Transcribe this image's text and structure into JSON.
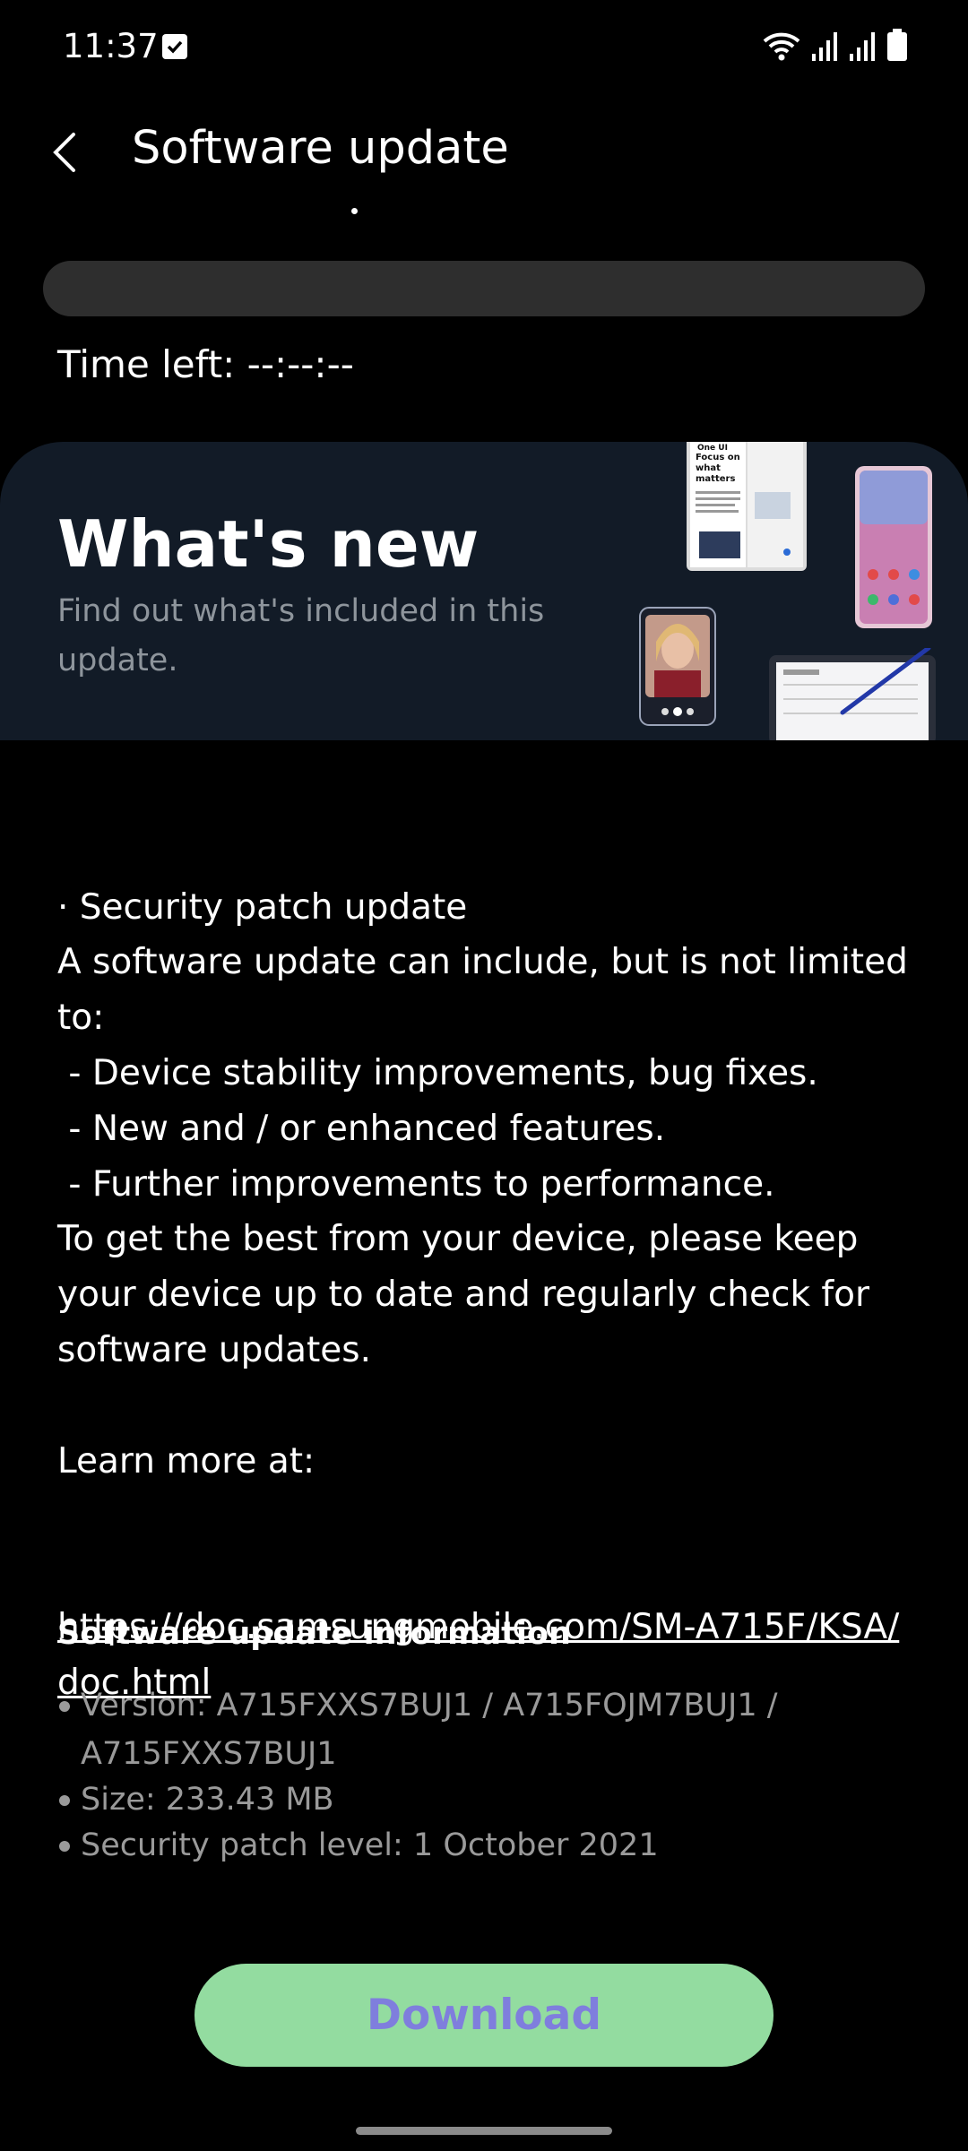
{
  "status_bar": {
    "time": "11:37",
    "icons": [
      "check-notification-icon",
      "wifi-icon",
      "signal-icon",
      "signal-icon",
      "battery-icon"
    ]
  },
  "app_bar": {
    "title": "Software update",
    "back_icon": "chevron-left-icon"
  },
  "download": {
    "progress_fraction": 0,
    "time_left": "Time left: --:--:--"
  },
  "banner": {
    "title": "What's new",
    "subtitle": "Find out what's included in this update.",
    "phone_text": {
      "brand": "One UI",
      "headline": "Focus on what matters"
    }
  },
  "release_notes": {
    "lines": [
      "· Security patch update",
      "A software update can include, but is not limited to:",
      " - Device stability improvements, bug fixes.",
      " - New and / or enhanced features.",
      " - Further improvements to performance.",
      "To get the best from your device, please keep your device up to date and regularly check for software updates.",
      "",
      "Learn more at:"
    ],
    "link": "https://doc.samsungmobile.com/SM-A715F/KSA/doc.html"
  },
  "info": {
    "title": "Software update information",
    "items": [
      "Version: A715FXXS7BUJ1 / A715FOJM7BUJ1 / A715FXXS7BUJ1",
      "Size: 233.43 MB",
      "Security patch level: 1 October 2021"
    ]
  },
  "button": {
    "label": "Download"
  },
  "colors": {
    "background": "#000000",
    "banner_background": "#121b27",
    "progress_track": "#2e2e2e",
    "button_background": "#93dca0",
    "button_text": "#7f7edd",
    "secondary_text": "#9a9a9a"
  }
}
